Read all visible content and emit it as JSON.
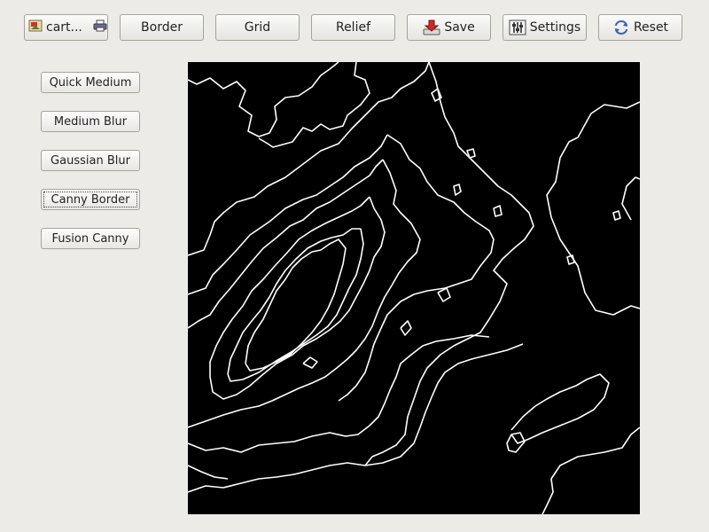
{
  "toolbar": {
    "file": {
      "label": "cart...",
      "doc_icon": "image-file-icon",
      "print_icon": "printer-icon"
    },
    "border": "Border",
    "grid": "Grid",
    "relief": "Relief",
    "save": {
      "label": "Save",
      "icon": "save-download-icon"
    },
    "settings": {
      "label": "Settings",
      "icon": "settings-sliders-icon"
    },
    "reset": {
      "label": "Reset",
      "icon": "reset-refresh-icon"
    }
  },
  "filters": [
    {
      "label": "Quick Medium"
    },
    {
      "label": "Medium Blur"
    },
    {
      "label": "Gaussian Blur"
    },
    {
      "label": "Canny Border",
      "focused": true
    },
    {
      "label": "Fusion Canny"
    }
  ],
  "viewer": {
    "background": "#000000",
    "line_color": "#ffffff"
  },
  "colors": {
    "window_bg": "#edebe7",
    "save_icon": "#cc2a2a",
    "reset_icon": "#3a62b8"
  }
}
